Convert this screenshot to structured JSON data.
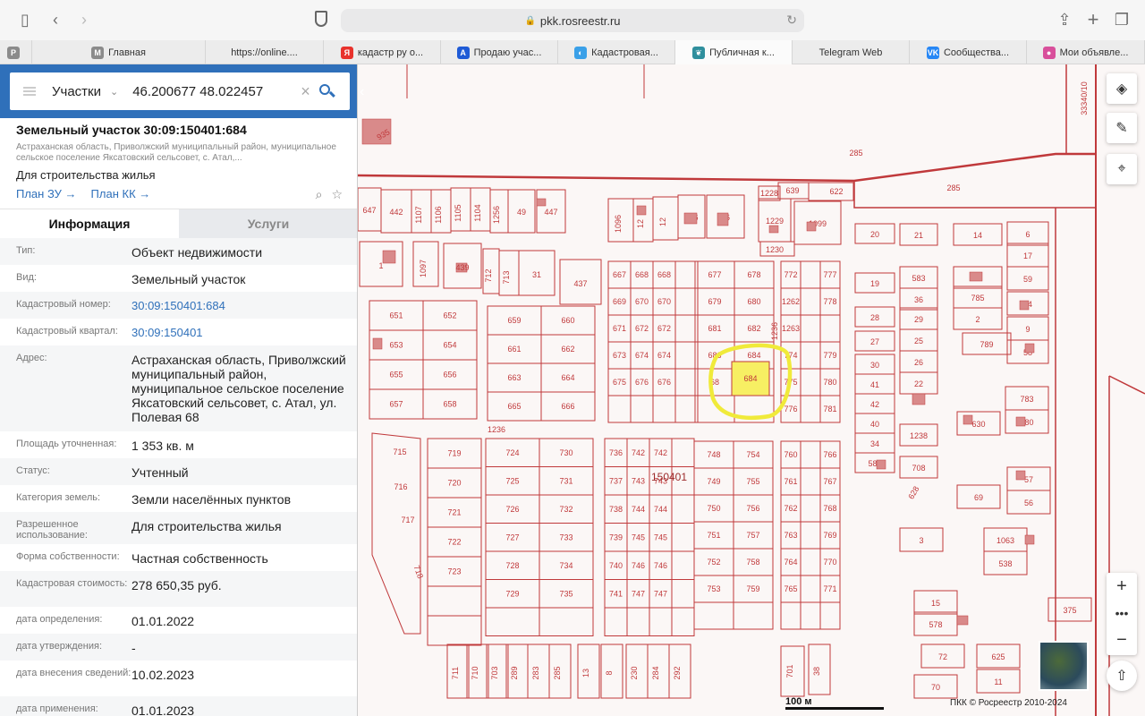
{
  "browser": {
    "url": "pkk.rosreestr.ru",
    "tabs": [
      {
        "label": "",
        "icon": "P",
        "color": "#8b8b8b",
        "width": 36
      },
      {
        "label": "Главная",
        "icon": "M",
        "color": "#8b8b8b",
        "width": 194
      },
      {
        "label": "https://online....",
        "icon": "",
        "color": "",
        "width": 132
      },
      {
        "label": "кадастр ру о...",
        "icon": "Я",
        "color": "#e8322c",
        "width": 131
      },
      {
        "label": "Продаю учас...",
        "icon": "A",
        "color": "#1f5bd6",
        "width": 131
      },
      {
        "label": "Кадастровая...",
        "icon": "◐",
        "color": "#3aa0e8",
        "width": 131
      },
      {
        "label": "Публичная к...",
        "icon": "❦",
        "color": "#2f8f9d",
        "width": 131,
        "active": true
      },
      {
        "label": "Telegram Web",
        "icon": "",
        "color": "",
        "width": 131
      },
      {
        "label": "Сообщества...",
        "icon": "VK",
        "color": "#2787f5",
        "width": 131
      },
      {
        "label": "Мои объявле...",
        "icon": "●",
        "color": "#d84f9b",
        "width": 132
      }
    ]
  },
  "search": {
    "type_label": "Участки",
    "query": "46.200677 48.022457"
  },
  "object": {
    "title": "Земельный участок 30:09:150401:684",
    "address_short": "Астраханская область, Приволжский муниципальный район, муниципальное сельское поселение Яксатовский сельсовет, с. Атал,...",
    "use": "Для строительства жилья",
    "plan_zu": "План ЗУ",
    "plan_kk": "План КК"
  },
  "info_tabs": {
    "info": "Информация",
    "services": "Услуги"
  },
  "rows": [
    {
      "k": "Тип:",
      "v": "Объект недвижимости"
    },
    {
      "k": "Вид:",
      "v": "Земельный участок"
    },
    {
      "k": "Кадастровый номер:",
      "v": "30:09:150401:684",
      "link": true
    },
    {
      "k": "Кадастровый квартал:",
      "v": "30:09:150401",
      "link": true
    },
    {
      "k": "Адрес:",
      "v": "Астраханская область, Приволжский муниципальный район, муниципальное сельское поселение Яксатовский сельсовет, с. Атал, ул. Полевая 68"
    },
    {
      "k": "Площадь уточненная:",
      "v": "1 353 кв. м"
    },
    {
      "k": "Статус:",
      "v": "Учтенный"
    },
    {
      "k": "Категория земель:",
      "v": "Земли населённых пунктов"
    },
    {
      "k": "Разрешенное использование:",
      "v": "Для строительства жилья"
    },
    {
      "k": "Форма собственности:",
      "v": "Частная собственность"
    },
    {
      "k": "Кадастровая стоимость:",
      "v": "278 650,35 руб."
    },
    {
      "k": "дата определения:",
      "v": "01.01.2022"
    },
    {
      "k": "дата утверждения:",
      "v": "-"
    },
    {
      "k": "дата внесения сведений:",
      "v": "10.02.2023"
    },
    {
      "k": "дата применения:",
      "v": "01.01.2023"
    }
  ],
  "map": {
    "quarter_label": "150401",
    "selected_parcel": "684",
    "scale_label": "100 м",
    "copyright": "ПКК © Росреестр 2010-2024",
    "colors": {
      "parcel": "#c0393b",
      "selected_fill": "#f7ef63",
      "highlight_ring": "#f0ea3a",
      "building": "#d98a8a"
    }
  }
}
